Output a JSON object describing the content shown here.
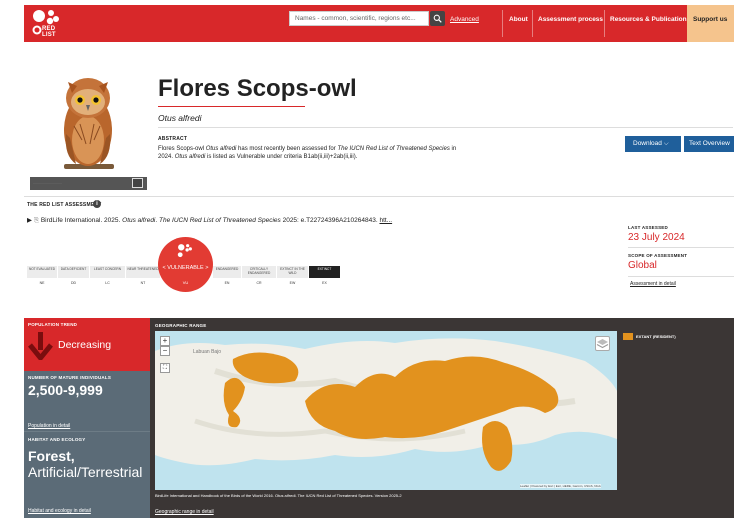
{
  "header": {
    "logo_text": "RED LIST",
    "search_placeholder": "Names - common, scientific, regions etc...",
    "advanced": "Advanced",
    "nav": [
      "About",
      "Assessment process",
      "Resources & Publications"
    ],
    "support": "Support us"
  },
  "species": {
    "common_name": "Flores Scops-owl",
    "scientific_name": "Otus alfredi",
    "abstract_label": "ABSTRACT",
    "abstract_p1": "Flores Scops-owl ",
    "abstract_p2": "Otus alfredi",
    "abstract_p3": " has most recently been assessed for ",
    "abstract_p4": "The IUCN Red List of Threatened Species",
    "abstract_p5": " in 2024. ",
    "abstract_p6": "Otus alfredi",
    "abstract_p7": " is listed as Vulnerable under criteria B1ab(ii,iii)+2ab(ii,iii).",
    "download": "Download",
    "text_overview": "Text Overview"
  },
  "assessment": {
    "label": "THE RED LIST ASSESSMENT",
    "citation_a": "BirdLife International. 2025. ",
    "citation_b": "Otus alfredi",
    "citation_c": ". ",
    "citation_d": "The IUCN Red List of Threatened Species",
    "citation_e": " 2025: e.T22724396A210264843. ",
    "citation_link": "htt...",
    "last_assessed_label": "LAST ASSESSED",
    "last_assessed": "23 July 2024",
    "scope_label": "SCOPE OF ASSESSMENT",
    "scope": "Global",
    "detail_link": "Assessment in detail"
  },
  "categories": [
    {
      "name": "NOT EVALUATED",
      "abbr": "NE"
    },
    {
      "name": "DATA DEFICIENT",
      "abbr": "DD"
    },
    {
      "name": "LEAST CONCERN",
      "abbr": "LC"
    },
    {
      "name": "NEAR THREATENED",
      "abbr": "NT"
    },
    {
      "name": "VULNERABLE",
      "abbr": "VU"
    },
    {
      "name": "ENDANGERED",
      "abbr": "EN"
    },
    {
      "name": "CRITICALLY ENDANGERED",
      "abbr": "CR"
    },
    {
      "name": "EXTINCT IN THE WILD",
      "abbr": "EW"
    },
    {
      "name": "EXTINCT",
      "abbr": "EX"
    }
  ],
  "vu_label": "VULNERABLE",
  "population": {
    "trend_label": "POPULATION TREND",
    "trend": "Decreasing",
    "mature_label": "NUMBER OF MATURE INDIVIDUALS",
    "mature": "2,500-9,999",
    "pop_link": "Population in detail"
  },
  "habitat": {
    "label": "HABITAT AND ECOLOGY",
    "value_bold": "Forest,",
    "value_rest": "Artificial/Terrestrial",
    "link": "Habitat and ecology in detail"
  },
  "map": {
    "label": "GEOGRAPHIC RANGE",
    "place": "Labuan Bajo",
    "attribution": "Leaflet | Powered by Esri | Esri, HERE, Garmin, USGS, NGA",
    "citation": "BirdLife International and Handbook of the Birds of the World 2016. Otus alfredi. The IUCN Red List of Threatened Species. Version 2025-2",
    "link": "Geographic range in detail",
    "legend": "EXTANT (RESIDENT)"
  },
  "colors": {
    "brand_red": "#d8282a",
    "range_orange": "#e2921e",
    "panel": "#3b3635",
    "slate": "#5b6b77",
    "button_blue": "#1f5f9b"
  }
}
